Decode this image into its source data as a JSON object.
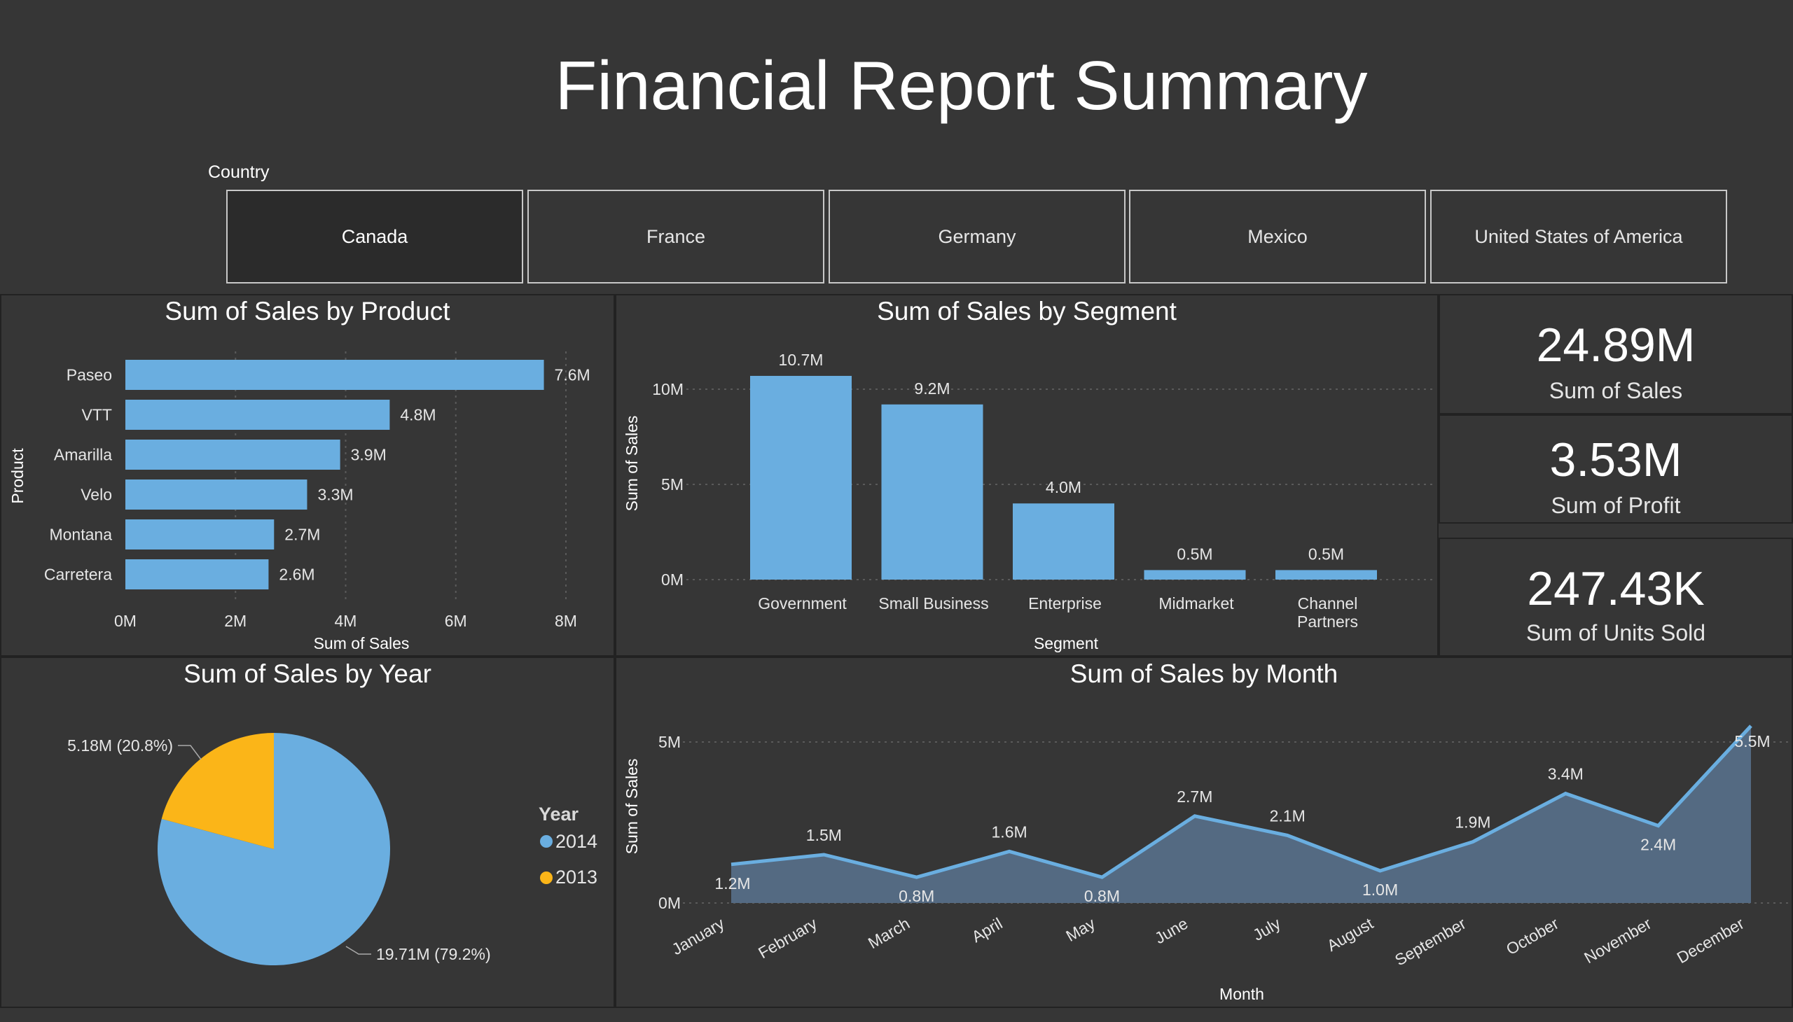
{
  "title": "Financial Report Summary",
  "slicer": {
    "label": "Country",
    "options": [
      "Canada",
      "France",
      "Germany",
      "Mexico",
      "United States of America"
    ],
    "selected": "Canada"
  },
  "colors": {
    "background": "#363636",
    "bar": "#6aaee0",
    "pie_2014": "#6aaee0",
    "pie_2013": "#fbb518",
    "area_fill": "#546a82"
  },
  "kpis": [
    {
      "value": "24.89M",
      "label": "Sum of  Sales"
    },
    {
      "value": "3.53M",
      "label": "Sum of Profit"
    },
    {
      "value": "247.43K",
      "label": "Sum of Units Sold"
    }
  ],
  "chart_data": [
    {
      "id": "product",
      "type": "bar",
      "orientation": "horizontal",
      "title": "Sum of Sales by Product",
      "xlabel": "Sum of Sales",
      "ylabel": "Product",
      "categories": [
        "Paseo",
        "VTT",
        "Amarilla",
        "Velo",
        "Montana",
        "Carretera"
      ],
      "values": [
        7.6,
        4.8,
        3.9,
        3.3,
        2.7,
        2.6
      ],
      "data_labels": [
        "7.6M",
        "4.8M",
        "3.9M",
        "3.3M",
        "2.7M",
        "2.6M"
      ],
      "xticks": [
        "0M",
        "2M",
        "4M",
        "6M",
        "8M"
      ],
      "xlim": [
        0,
        8
      ],
      "unit": "M",
      "grid": true
    },
    {
      "id": "segment",
      "type": "bar",
      "title": "Sum of Sales by Segment",
      "xlabel": "Segment",
      "ylabel": "Sum of Sales",
      "categories": [
        "Government",
        "Small Business",
        "Enterprise",
        "Midmarket",
        "Channel Partners"
      ],
      "values": [
        10.7,
        9.2,
        4.0,
        0.5,
        0.5
      ],
      "data_labels": [
        "10.7M",
        "9.2M",
        "4.0M",
        "0.5M",
        "0.5M"
      ],
      "yticks": [
        "0M",
        "5M",
        "10M"
      ],
      "ylim": [
        0,
        12
      ],
      "unit": "M",
      "grid": true
    },
    {
      "id": "year",
      "type": "pie",
      "title": "Sum of Sales by Year",
      "legend_title": "Year",
      "legend_position": "right",
      "slices": [
        {
          "label": "2014",
          "value": 19.71,
          "percent": 79.2,
          "text": "19.71M (79.2%)"
        },
        {
          "label": "2013",
          "value": 5.18,
          "percent": 20.8,
          "text": "5.18M (20.8%)"
        }
      ]
    },
    {
      "id": "month",
      "type": "area",
      "title": "Sum of Sales by Month",
      "xlabel": "Month",
      "ylabel": "Sum of Sales",
      "categories": [
        "January",
        "February",
        "March",
        "April",
        "May",
        "June",
        "July",
        "August",
        "September",
        "October",
        "November",
        "December"
      ],
      "values": [
        1.2,
        1.5,
        0.8,
        1.6,
        0.8,
        2.7,
        2.1,
        1.0,
        1.9,
        3.4,
        2.4,
        5.5
      ],
      "data_labels": [
        "1.2M",
        "1.5M",
        "0.8M",
        "1.6M",
        "0.8M",
        "2.7M",
        "2.1M",
        "1.0M",
        "1.9M",
        "3.4M",
        "2.4M",
        "5.5M"
      ],
      "yticks": [
        "0M",
        "5M"
      ],
      "ylim": [
        0,
        5.8
      ],
      "unit": "M",
      "grid": true
    }
  ]
}
